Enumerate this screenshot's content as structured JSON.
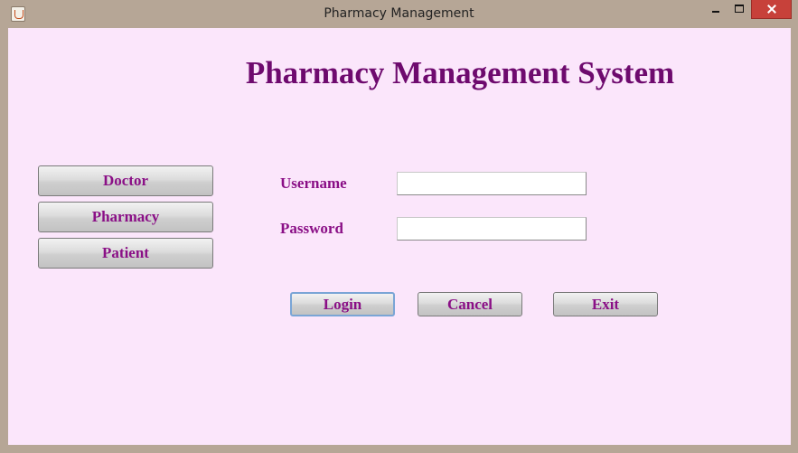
{
  "window": {
    "title": "Pharmacy Management",
    "controls": {
      "minimize": "minimize-icon",
      "maximize": "maximize-icon",
      "close": "close-icon"
    }
  },
  "header": {
    "title": "Pharmacy Management System"
  },
  "sidebar": {
    "items": [
      {
        "label": "Doctor"
      },
      {
        "label": "Pharmacy"
      },
      {
        "label": "Patient"
      }
    ]
  },
  "login_form": {
    "username_label": "Username",
    "username_value": "",
    "password_label": "Password",
    "password_value": ""
  },
  "actions": {
    "login_label": "Login",
    "cancel_label": "Cancel",
    "exit_label": "Exit"
  },
  "colors": {
    "background": "#fbe6fb",
    "heading": "#6e0a6e",
    "label": "#8a0f86",
    "close_button": "#c7413a"
  }
}
